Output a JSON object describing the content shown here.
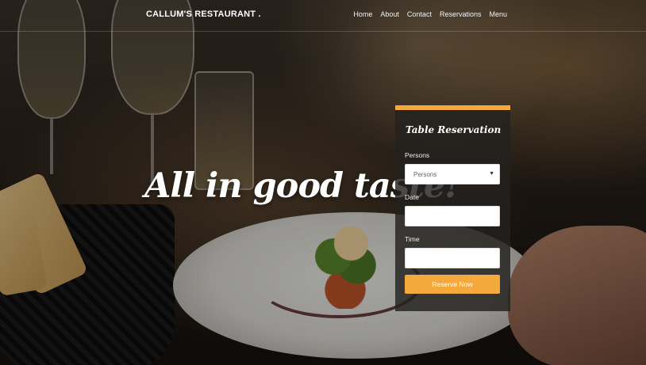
{
  "header": {
    "brand": "CALLUM'S RESTAURANT .",
    "nav": [
      {
        "label": "Home"
      },
      {
        "label": "About"
      },
      {
        "label": "Contact"
      },
      {
        "label": "Reservations"
      },
      {
        "label": "Menu"
      }
    ]
  },
  "hero": {
    "tagline": "All in good taste!"
  },
  "reservation": {
    "title": "Table Reservation",
    "persons_label": "Persons",
    "persons_value": "Persons",
    "date_label": "Date",
    "date_value": "",
    "time_label": "Time",
    "time_value": "",
    "submit_label": "Reserve Now"
  },
  "colors": {
    "accent": "#f3a93b",
    "panel_bg": "#23211f"
  },
  "icons": {
    "select_arrow": "caret-down-icon"
  }
}
